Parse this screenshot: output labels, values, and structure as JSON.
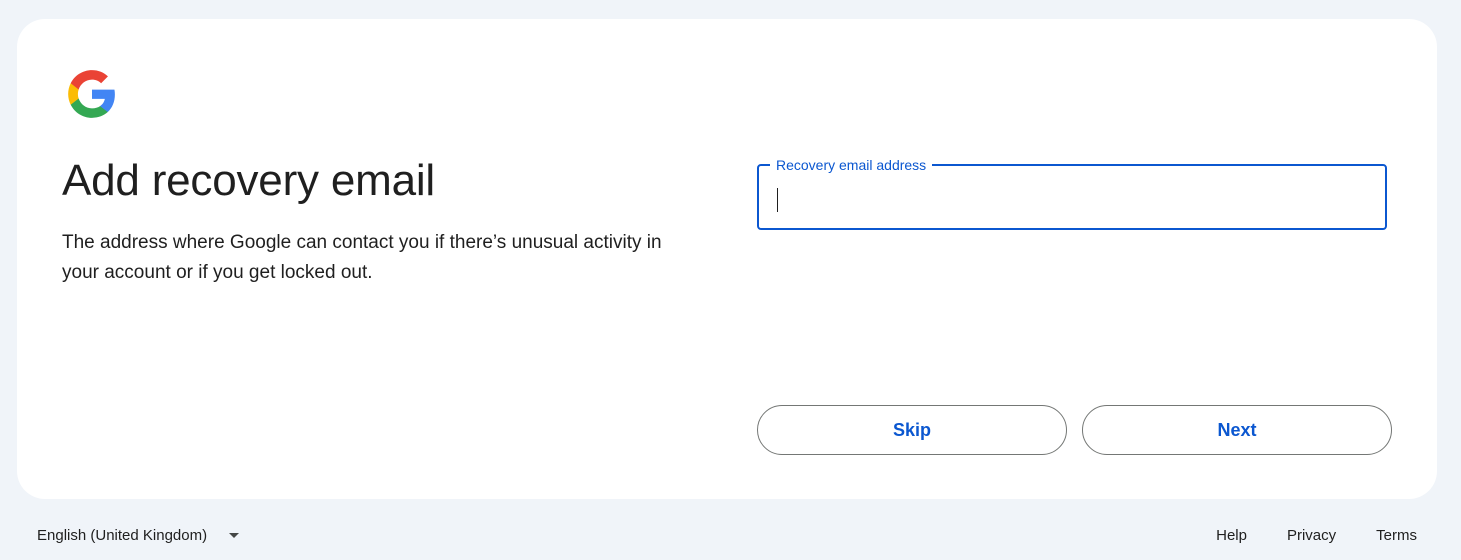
{
  "header": {
    "logo_icon": "google-g-icon"
  },
  "main": {
    "title": "Add recovery email",
    "description": "The address where Google can contact you if there’s unusual activity in your account or if you get locked out."
  },
  "form": {
    "email_label": "Recovery email address",
    "email_value": "",
    "accent_color": "#0b57d0"
  },
  "actions": {
    "skip_label": "Skip",
    "next_label": "Next"
  },
  "footer": {
    "language": "English (United Kingdom)",
    "links": {
      "help": "Help",
      "privacy": "Privacy",
      "terms": "Terms"
    }
  }
}
